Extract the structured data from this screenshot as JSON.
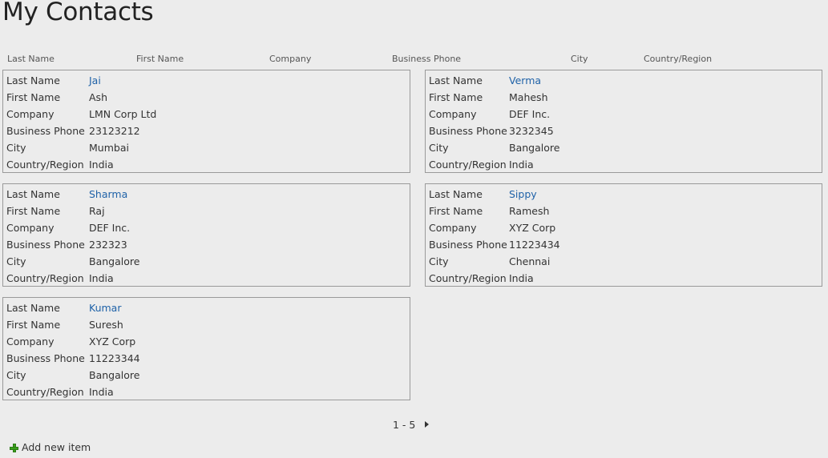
{
  "title": "My Contacts",
  "columns": [
    "Last Name",
    "First Name",
    "Company",
    "Business Phone",
    "City",
    "Country/Region"
  ],
  "field_labels": [
    "Last Name",
    "First Name",
    "Company",
    "Business Phone",
    "City",
    "Country/Region"
  ],
  "link_color": "#1f62a8",
  "contacts": [
    {
      "last_name": "Jai",
      "first_name": "Ash",
      "company": "LMN Corp Ltd",
      "business_phone": "23123212",
      "city": "Mumbai",
      "country": "India"
    },
    {
      "last_name": "Verma",
      "first_name": "Mahesh",
      "company": "DEF Inc.",
      "business_phone": "3232345",
      "city": "Bangalore",
      "country": "India"
    },
    {
      "last_name": "Sharma",
      "first_name": "Raj",
      "company": "DEF Inc.",
      "business_phone": "232323",
      "city": "Bangalore",
      "country": "India"
    },
    {
      "last_name": "Sippy",
      "first_name": "Ramesh",
      "company": "XYZ Corp",
      "business_phone": "11223434",
      "city": "Chennai",
      "country": "India"
    },
    {
      "last_name": "Kumar",
      "first_name": "Suresh",
      "company": "XYZ Corp",
      "business_phone": "11223344",
      "city": "Bangalore",
      "country": "India"
    }
  ],
  "pager": {
    "range": "1 - 5",
    "next_icon": "triangle-right-icon"
  },
  "add_new": {
    "label": "Add new item",
    "icon": "plus-icon"
  }
}
